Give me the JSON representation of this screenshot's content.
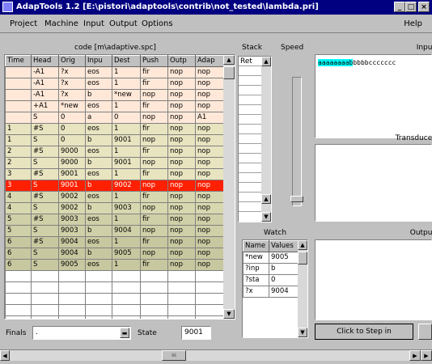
{
  "window": {
    "title": "AdapTools 1.2 [E:\\pistori\\adaptools\\contrib\\not_tested\\lambda.pri]",
    "minimize": "_",
    "maximize": "□",
    "close": "×"
  },
  "menu": {
    "items": [
      "Project",
      "Machine",
      "Input",
      "Output",
      "Options"
    ],
    "help": "Help"
  },
  "code": {
    "title": "code [m\\adaptive.spc]",
    "columns": [
      "Time",
      "Head",
      "Orig",
      "Inpu",
      "Dest",
      "Push",
      "Outp",
      "Adap"
    ],
    "rows": [
      [
        "",
        "-A1",
        "?x",
        "eos",
        "1",
        "fir",
        "nop",
        "nop"
      ],
      [
        "",
        "-A1",
        "?x",
        "eos",
        "1",
        "fir",
        "nop",
        "nop"
      ],
      [
        "",
        "-A1",
        "?x",
        "b",
        "*new",
        "nop",
        "nop",
        "nop"
      ],
      [
        "",
        "+A1",
        "*new",
        "eos",
        "1",
        "fir",
        "nop",
        "nop"
      ],
      [
        "",
        "S",
        "0",
        "a",
        "0",
        "nop",
        "nop",
        "A1"
      ],
      [
        "1",
        "#S",
        "0",
        "eos",
        "1",
        "fir",
        "nop",
        "nop"
      ],
      [
        "1",
        "S",
        "0",
        "b",
        "9001",
        "nop",
        "nop",
        "nop"
      ],
      [
        "2",
        "#S",
        "9000",
        "eos",
        "1",
        "fir",
        "nop",
        "nop"
      ],
      [
        "2",
        "S",
        "9000",
        "b",
        "9001",
        "nop",
        "nop",
        "nop"
      ],
      [
        "3",
        "#S",
        "9001",
        "eos",
        "1",
        "fir",
        "nop",
        "nop"
      ],
      [
        "3",
        "S",
        "9001",
        "b",
        "9002",
        "nop",
        "nop",
        "nop"
      ],
      [
        "4",
        "#S",
        "9002",
        "eos",
        "1",
        "fir",
        "nop",
        "nop"
      ],
      [
        "4",
        "S",
        "9002",
        "b",
        "9003",
        "nop",
        "nop",
        "nop"
      ],
      [
        "5",
        "#S",
        "9003",
        "eos",
        "1",
        "fir",
        "nop",
        "nop"
      ],
      [
        "5",
        "S",
        "9003",
        "b",
        "9004",
        "nop",
        "nop",
        "nop"
      ],
      [
        "6",
        "#S",
        "9004",
        "eos",
        "1",
        "fir",
        "nop",
        "nop"
      ],
      [
        "6",
        "S",
        "9004",
        "b",
        "9005",
        "nop",
        "nop",
        "nop"
      ],
      [
        "6",
        "S",
        "9005",
        "eos",
        "1",
        "fir",
        "nop",
        "nop"
      ]
    ],
    "row_colors": [
      "#ffe8d8",
      "#ffe8d8",
      "#ffe8d8",
      "#ffe8d8",
      "#ffe8d8",
      "#e8e4c0",
      "#e8e4c0",
      "#e8e4c0",
      "#e8e4c0",
      "#e8e4c0",
      "#ff2000",
      "#d8d8b0",
      "#d8d8b0",
      "#d0d0a8",
      "#d0d0a8",
      "#c8c8a0",
      "#c8c8a0",
      "#c8c8a0"
    ]
  },
  "finals": {
    "label": "Finals",
    "value": "."
  },
  "state": {
    "label": "State",
    "value": "9001"
  },
  "stack": {
    "title": "Stack",
    "items": [
      "Ret"
    ]
  },
  "speed": {
    "title": "Speed"
  },
  "input": {
    "title": "Input",
    "consumed": "aaaaaaaab",
    "remaining": "bbbbccccccc"
  },
  "transducer": {
    "title": "Transducer"
  },
  "output": {
    "title": "Output"
  },
  "watch": {
    "title": "Watch",
    "columns": [
      "Name",
      "Values"
    ],
    "rows": [
      [
        "*new",
        "9005"
      ],
      [
        "?inp",
        "b"
      ],
      [
        "?sta",
        "0"
      ],
      [
        "?x",
        "9004"
      ]
    ]
  },
  "step_button": {
    "label": "Click to Step in"
  },
  "colors": {
    "titlebar": "#000080",
    "current_row": "#ff2000",
    "input_highlight": "#00ffff"
  }
}
